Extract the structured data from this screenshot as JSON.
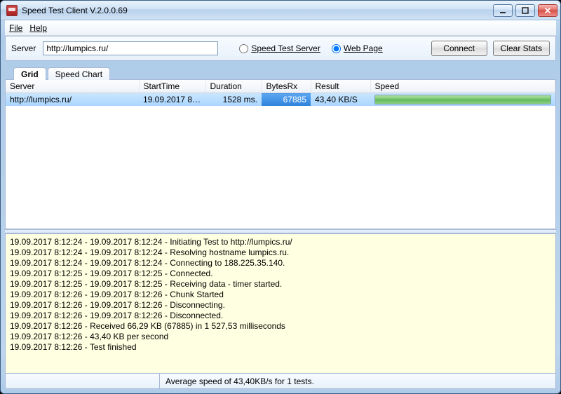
{
  "window": {
    "title": "Speed Test Client V.2.0.0.69"
  },
  "menubar": {
    "file": "File",
    "help": "Help"
  },
  "toolbar": {
    "server_label": "Server",
    "server_url": "http://lumpics.ru/",
    "radio_speed_server": "Speed Test Server",
    "radio_web_page": "Web Page",
    "selected_radio": "web_page",
    "connect_label": "Connect",
    "clear_label": "Clear Stats"
  },
  "tabs": {
    "grid": "Grid",
    "speed_chart": "Speed Chart",
    "active": "grid"
  },
  "grid": {
    "columns": {
      "server": "Server",
      "start_time": "StartTime",
      "duration": "Duration",
      "bytes_rx": "BytesRx",
      "result": "Result",
      "speed": "Speed"
    },
    "rows": [
      {
        "server": "http://lumpics.ru/",
        "start_time": "19.09.2017 8:...",
        "duration": "1528 ms.",
        "bytes_rx": "67885",
        "result": "43,40 KB/S",
        "speed_fill_pct": 100,
        "selected": true
      }
    ]
  },
  "log": {
    "lines": [
      "19.09.2017 8:12:24 - 19.09.2017 8:12:24 - Initiating Test to http://lumpics.ru/",
      "19.09.2017 8:12:24 - 19.09.2017 8:12:24 - Resolving hostname lumpics.ru.",
      "19.09.2017 8:12:24 - 19.09.2017 8:12:24 - Connecting to 188.225.35.140.",
      "19.09.2017 8:12:25 - 19.09.2017 8:12:25 - Connected.",
      "19.09.2017 8:12:25 - 19.09.2017 8:12:25 - Receiving data - timer started.",
      "19.09.2017 8:12:26 - 19.09.2017 8:12:26 - Chunk Started",
      "19.09.2017 8:12:26 - 19.09.2017 8:12:26 - Disconnecting.",
      "19.09.2017 8:12:26 - 19.09.2017 8:12:26 - Disconnected.",
      "19.09.2017 8:12:26 - Received 66,29 KB (67885) in 1 527,53 milliseconds",
      "19.09.2017 8:12:26 - 43,40 KB per second",
      "19.09.2017 8:12:26 - Test finished"
    ]
  },
  "statusbar": {
    "text": "Average speed of 43,40KB/s for 1 tests."
  }
}
